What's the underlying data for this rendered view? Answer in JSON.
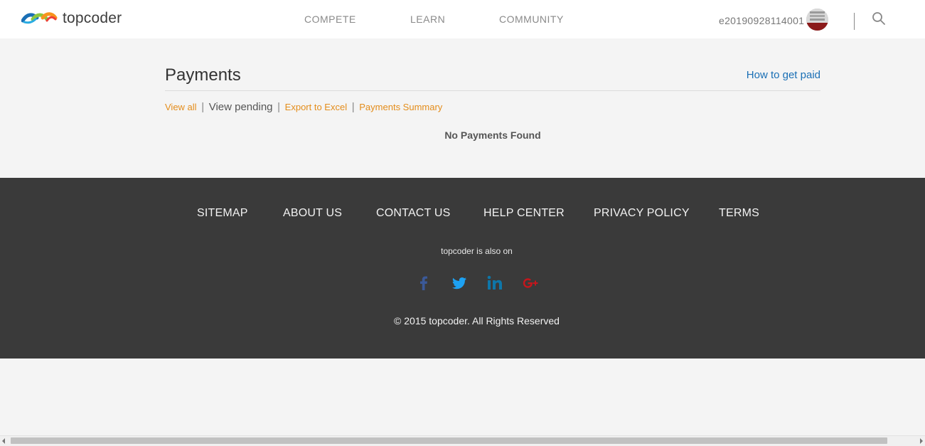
{
  "header": {
    "logo_text": "topcoder",
    "nav": [
      "COMPETE",
      "LEARN",
      "COMMUNITY"
    ],
    "username": "e20190928114001"
  },
  "main": {
    "title": "Payments",
    "help_link": "How to get paid",
    "subnav": {
      "view_all": "View all",
      "sep": "|",
      "view_pending": "View pending",
      "export": "Export to Excel",
      "summary": "Payments Summary"
    },
    "empty_message": "No Payments Found"
  },
  "footer": {
    "links": [
      "SITEMAP",
      "ABOUT US",
      "CONTACT US",
      "HELP CENTER",
      "PRIVACY POLICY",
      "TERMS"
    ],
    "also_on": "topcoder is also on",
    "social": [
      "facebook-icon",
      "twitter-icon",
      "linkedin-icon",
      "google-plus-icon"
    ],
    "copyright": "© 2015 topcoder. All Rights Reserved"
  },
  "colors": {
    "accent_orange": "#e48d1b",
    "link_blue": "#1a6fb5",
    "footer_bg": "#3a3a3a",
    "facebook": "#3b5998",
    "twitter": "#1da1f2",
    "linkedin": "#0e76a8",
    "google_plus": "#c4161c"
  }
}
